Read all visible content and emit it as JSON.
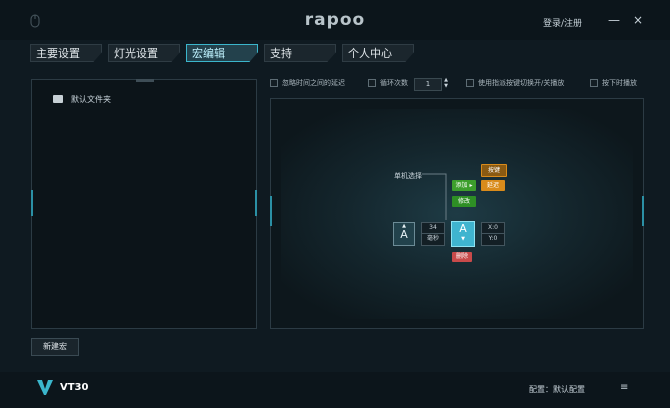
{
  "titlebar": {
    "logo": "rapoo",
    "login": "登录/注册",
    "minimize_glyph": "—",
    "close_glyph": "×",
    "mouse_icon": "mouse-icon"
  },
  "tabs": [
    {
      "label": "主要设置"
    },
    {
      "label": "灯光设置"
    },
    {
      "label": "宏编辑"
    },
    {
      "label": "支持"
    },
    {
      "label": "个人中心"
    }
  ],
  "left_panel": {
    "folder_label": "默认文件夹",
    "new_macro": "新建宏"
  },
  "options": {
    "ignore_delay": "忽略时间之间的延迟",
    "loop_count": "循环次数",
    "loop_value": "1",
    "toggle_play": "使用指派按键切换开/关播放",
    "hold_play": "按下时播放"
  },
  "editor": {
    "single_select": "单机选择",
    "key_btn": "按键",
    "add_btn": "添加 ▸",
    "delay_btn": "延迟",
    "modify_btn": "修改",
    "key_a_left": "A",
    "key_a_right": "A",
    "arrow_up": "▲",
    "arrow_down": "▼",
    "delay_value": "34",
    "delay_unit": "毫秒",
    "x_coord": "X:0",
    "y_coord": "Y:0",
    "delete_btn": "删除"
  },
  "bottom": {
    "model": "VT30",
    "config_label": "配置：",
    "config_value": "默认配置",
    "menu_glyph": "≡"
  },
  "colors": {
    "accent": "#3bb6cc",
    "green": "#3d9f2c",
    "orange": "#d98b1b",
    "red": "#c84a4a"
  }
}
